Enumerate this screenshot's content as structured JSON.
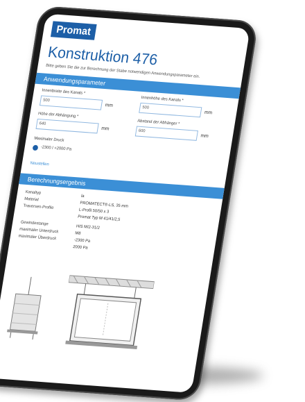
{
  "header": {
    "logo": "Promat",
    "title": "Konstruktion 476",
    "intro": "Bitte geben Sie die zur Berechnung der Stabe notwendigen Anwendungsparameter ein."
  },
  "params": {
    "section_title": "Anwendungsparameter",
    "width": {
      "label": "Innenbreite des Kanals *",
      "value": "500",
      "unit": "mm"
    },
    "height": {
      "label": "Innenhöhe des Kanals *",
      "value": "500",
      "unit": "mm"
    },
    "hanger_height": {
      "label": "Höhe der Abhängung *",
      "value": "640",
      "unit": "mm"
    },
    "hanger_distance": {
      "label": "Abstand der Abhänger *",
      "value": "600",
      "unit": "mm"
    },
    "pressure": {
      "label": "Maximaler Druck",
      "option": "-2300 / +2000 Pa"
    },
    "reset": "Neustellen"
  },
  "results": {
    "section_title": "Berechnungsergebnis",
    "rows": [
      {
        "key": "Kanaltyp",
        "value": "la"
      },
      {
        "key": "Material",
        "value": "PROMATECT®-LS, 35 mm"
      },
      {
        "key": "Traversen-Profile",
        "value": "L-Profil 50/50 x 3"
      },
      {
        "key": "",
        "value": "Promat Typ M 41/41/2,5"
      },
      {
        "key": "Gewindestange",
        "value": "HIS M/2-31/2"
      },
      {
        "key": "maximaler Unterdruck",
        "value": "M8"
      },
      {
        "key": "maximaler Überdruck",
        "value": "-2300 Pa"
      },
      {
        "key": "",
        "value": "2000 Pa"
      }
    ]
  },
  "colors": {
    "brand": "#1d5fa7",
    "bar": "#3b8fd6"
  }
}
